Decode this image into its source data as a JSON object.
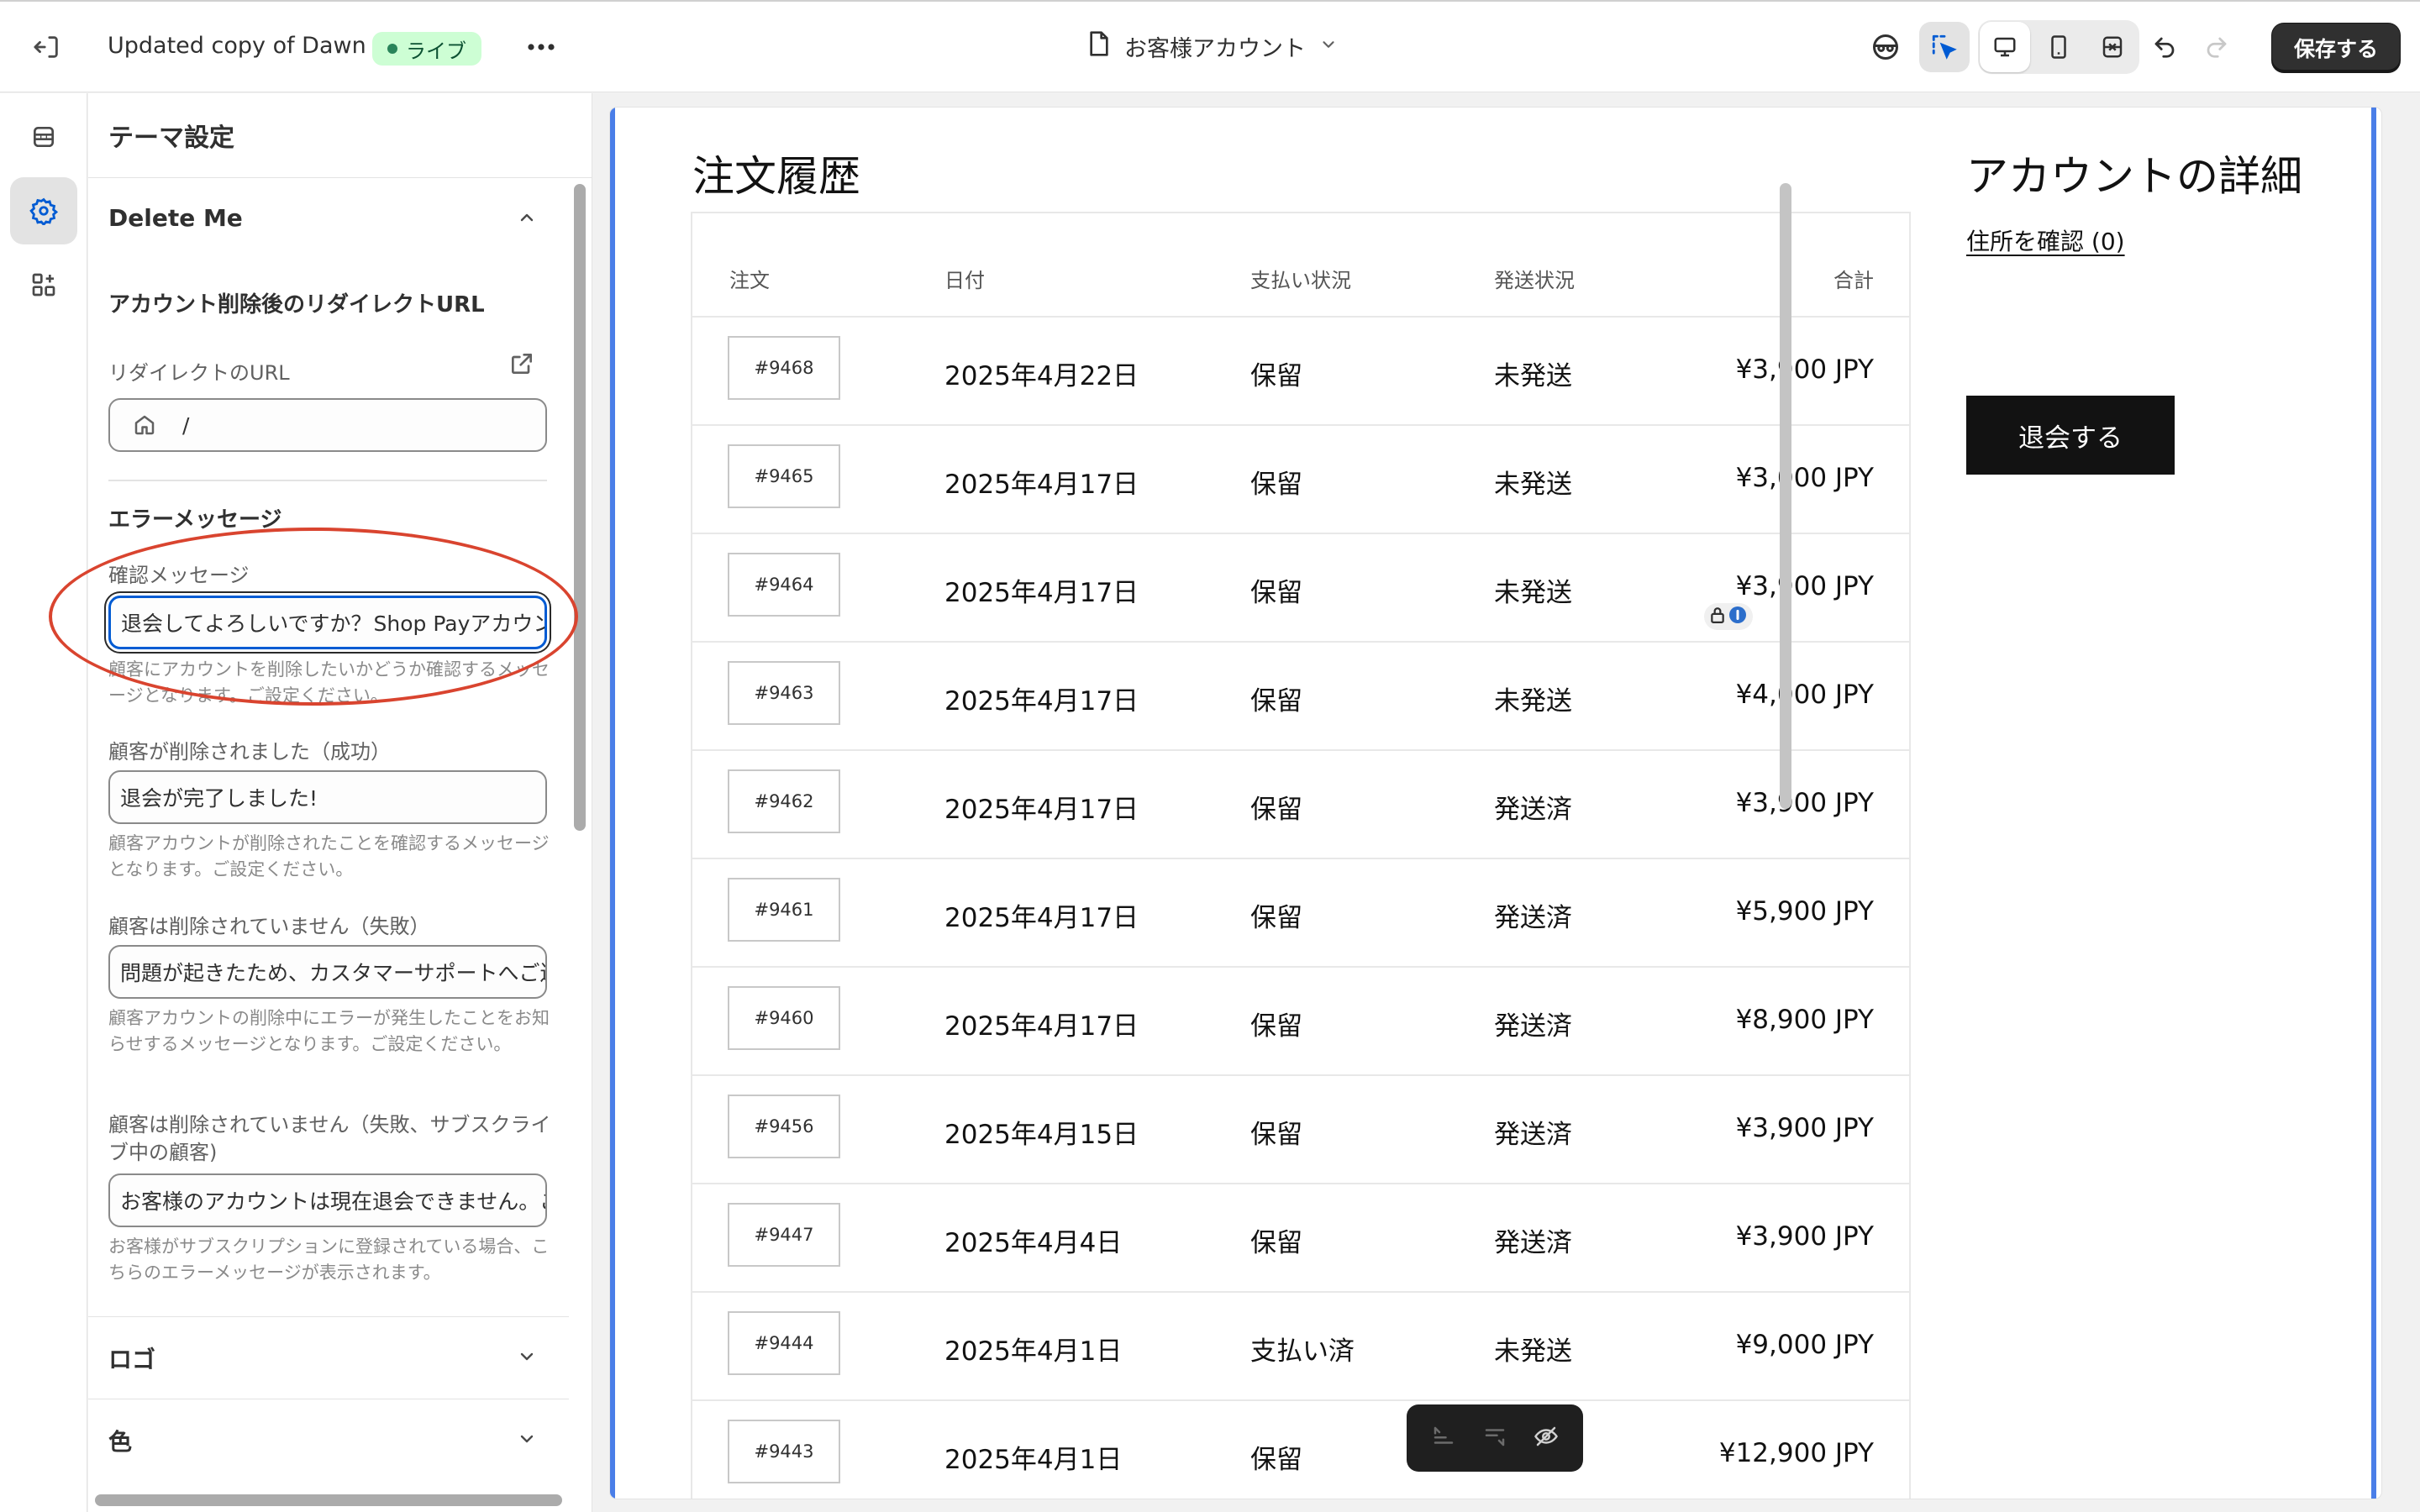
{
  "topbar": {
    "theme_name": "Updated copy of Dawn",
    "live_label": "ライブ",
    "page_selector": "お客様アカウント",
    "save_label": "保存する"
  },
  "panel": {
    "title": "テーマ設定",
    "section_delete_me": "Delete Me",
    "redirect_heading": "アカウント削除後のリダイレクトURL",
    "redirect_label": "リダイレクトのURL",
    "redirect_value": "/",
    "error_heading": "エラーメッセージ",
    "confirm_label": "確認メッセージ",
    "confirm_value_before": "退会してよろしいですか？",
    "confirm_value_after": "Shop Payアカウン",
    "confirm_help": "顧客にアカウントを削除したいかどうか確認するメッセージとなります。ご設定ください。",
    "success_label": "顧客が削除されました（成功）",
    "success_value": "退会が完了しました!",
    "success_help": "顧客アカウントが削除されたことを確認するメッセージとなります。ご設定ください。",
    "fail_label": "顧客は削除されていません（失敗）",
    "fail_value": "問題が起きたため、カスタマーサポートへご連",
    "fail_help": "顧客アカウントの削除中にエラーが発生したことをお知らせするメッセージとなります。ご設定ください。",
    "fail_sub_label": "顧客は削除されていません（失敗、サブスクライブ中の顧客)",
    "fail_sub_value": "お客様のアカウントは現在退会できません。ご",
    "fail_sub_help": "お客様がサブスクリプションに登録されている場合、こちらのエラーメッセージが表示されます。",
    "section_logo": "ロゴ",
    "section_color": "色"
  },
  "preview": {
    "orders_title": "注文履歴",
    "columns": [
      "注文",
      "日付",
      "支払い状況",
      "発送状況",
      "合計"
    ],
    "orders": [
      {
        "id": "#9468",
        "date": "2025年4月22日",
        "payment": "保留",
        "fulfillment": "未発送",
        "total": "¥3,900 JPY"
      },
      {
        "id": "#9465",
        "date": "2025年4月17日",
        "payment": "保留",
        "fulfillment": "未発送",
        "total": "¥3,000 JPY"
      },
      {
        "id": "#9464",
        "date": "2025年4月17日",
        "payment": "保留",
        "fulfillment": "未発送",
        "total": "¥3,900 JPY"
      },
      {
        "id": "#9463",
        "date": "2025年4月17日",
        "payment": "保留",
        "fulfillment": "未発送",
        "total": "¥4,000 JPY"
      },
      {
        "id": "#9462",
        "date": "2025年4月17日",
        "payment": "保留",
        "fulfillment": "発送済",
        "total": "¥3,900 JPY"
      },
      {
        "id": "#9461",
        "date": "2025年4月17日",
        "payment": "保留",
        "fulfillment": "発送済",
        "total": "¥5,900 JPY"
      },
      {
        "id": "#9460",
        "date": "2025年4月17日",
        "payment": "保留",
        "fulfillment": "発送済",
        "total": "¥8,900 JPY"
      },
      {
        "id": "#9456",
        "date": "2025年4月15日",
        "payment": "保留",
        "fulfillment": "発送済",
        "total": "¥3,900 JPY"
      },
      {
        "id": "#9447",
        "date": "2025年4月4日",
        "payment": "保留",
        "fulfillment": "発送済",
        "total": "¥3,900 JPY"
      },
      {
        "id": "#9444",
        "date": "2025年4月1日",
        "payment": "支払い済",
        "fulfillment": "未発送",
        "total": "¥9,000 JPY"
      },
      {
        "id": "#9443",
        "date": "2025年4月1日",
        "payment": "保留",
        "fulfillment": "",
        "total": "¥12,900 JPY"
      }
    ],
    "account_title": "アカウントの詳細",
    "address_link": "住所を確認 (0)",
    "leave_button": "退会する"
  },
  "colors": {
    "accent": "#005bd3",
    "live_badge_bg": "#cdfed4",
    "annotation": "#d9442f",
    "preview_border": "#4a7ee8"
  },
  "icons": [
    "exit-icon",
    "more-icon",
    "page-icon",
    "chevron-down-icon",
    "mask-icon",
    "inspector-icon",
    "desktop-icon",
    "mobile-icon",
    "fullwidth-icon",
    "undo-icon",
    "redo-icon",
    "sections-icon",
    "settings-icon",
    "apps-icon",
    "external-link-icon",
    "home-icon",
    "chevron-up-icon",
    "lock-icon",
    "info-icon",
    "hide-icon"
  ]
}
